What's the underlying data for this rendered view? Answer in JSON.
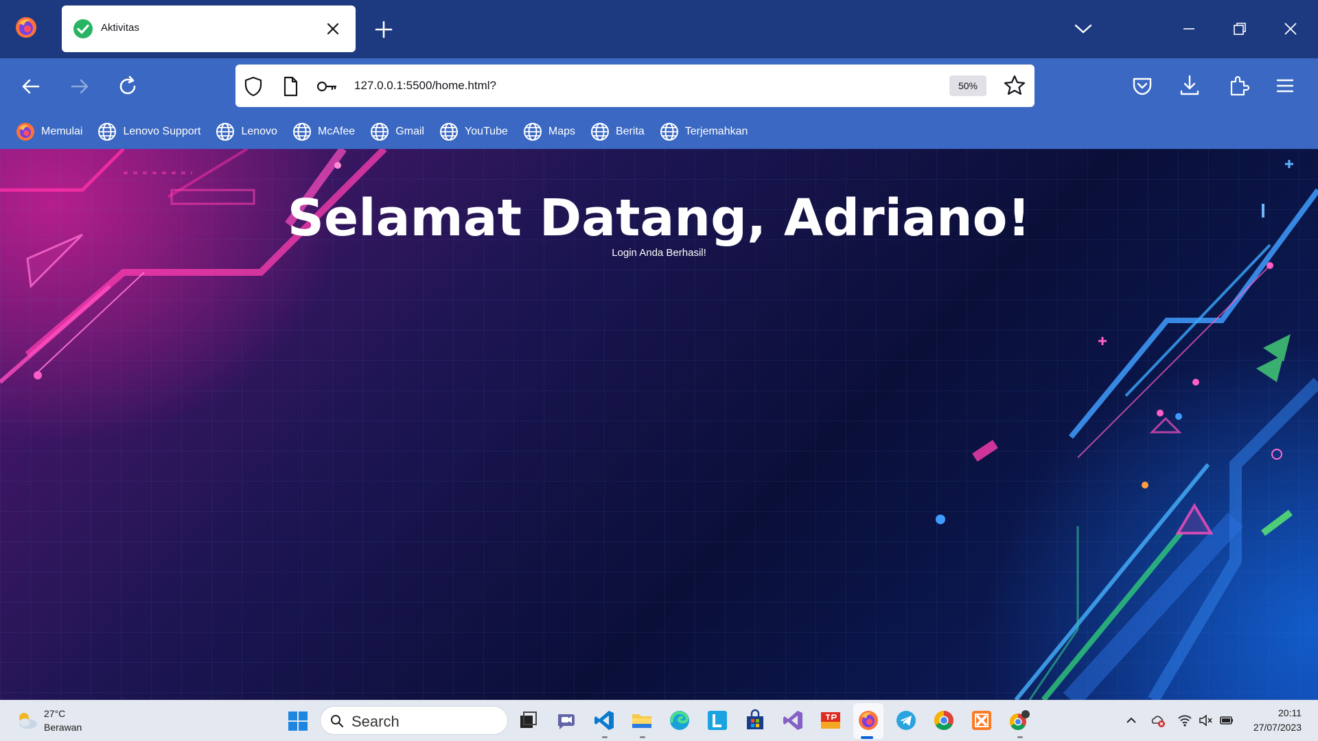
{
  "browser": {
    "tab": {
      "title": "Aktivitas"
    },
    "address_bar": {
      "url": "127.0.0.1:5500/home.html?",
      "zoom": "50%"
    },
    "bookmarks": [
      {
        "label": "Memulai",
        "icon": "firefox-icon"
      },
      {
        "label": "Lenovo Support",
        "icon": "globe-icon"
      },
      {
        "label": "Lenovo",
        "icon": "globe-icon"
      },
      {
        "label": "McAfee",
        "icon": "globe-icon"
      },
      {
        "label": "Gmail",
        "icon": "globe-icon"
      },
      {
        "label": "YouTube",
        "icon": "globe-icon"
      },
      {
        "label": "Maps",
        "icon": "globe-icon"
      },
      {
        "label": "Berita",
        "icon": "globe-icon"
      },
      {
        "label": "Terjemahkan",
        "icon": "globe-icon"
      }
    ]
  },
  "page": {
    "heading": "Selamat Datang, Adriano!",
    "subtext": "Login Anda Berhasil!"
  },
  "taskbar": {
    "weather": {
      "temp": "27°C",
      "condition": "Berawan"
    },
    "search_label": "Search",
    "apps": [
      "file-explorer-dark",
      "teams-chat",
      "vscode",
      "file-explorer",
      "edge",
      "l-app",
      "microsoft-store",
      "visual-studio",
      "tp-app",
      "firefox",
      "telegram",
      "chrome",
      "xampp",
      "chrome-profile"
    ],
    "clock": {
      "time": "20:11",
      "date": "27/07/2023"
    }
  },
  "colors": {
    "tab_strip": "#1d3a80",
    "toolbar": "#3a68c2",
    "page_bg": "#0a0f38",
    "taskbar": "#e4e8f0"
  }
}
